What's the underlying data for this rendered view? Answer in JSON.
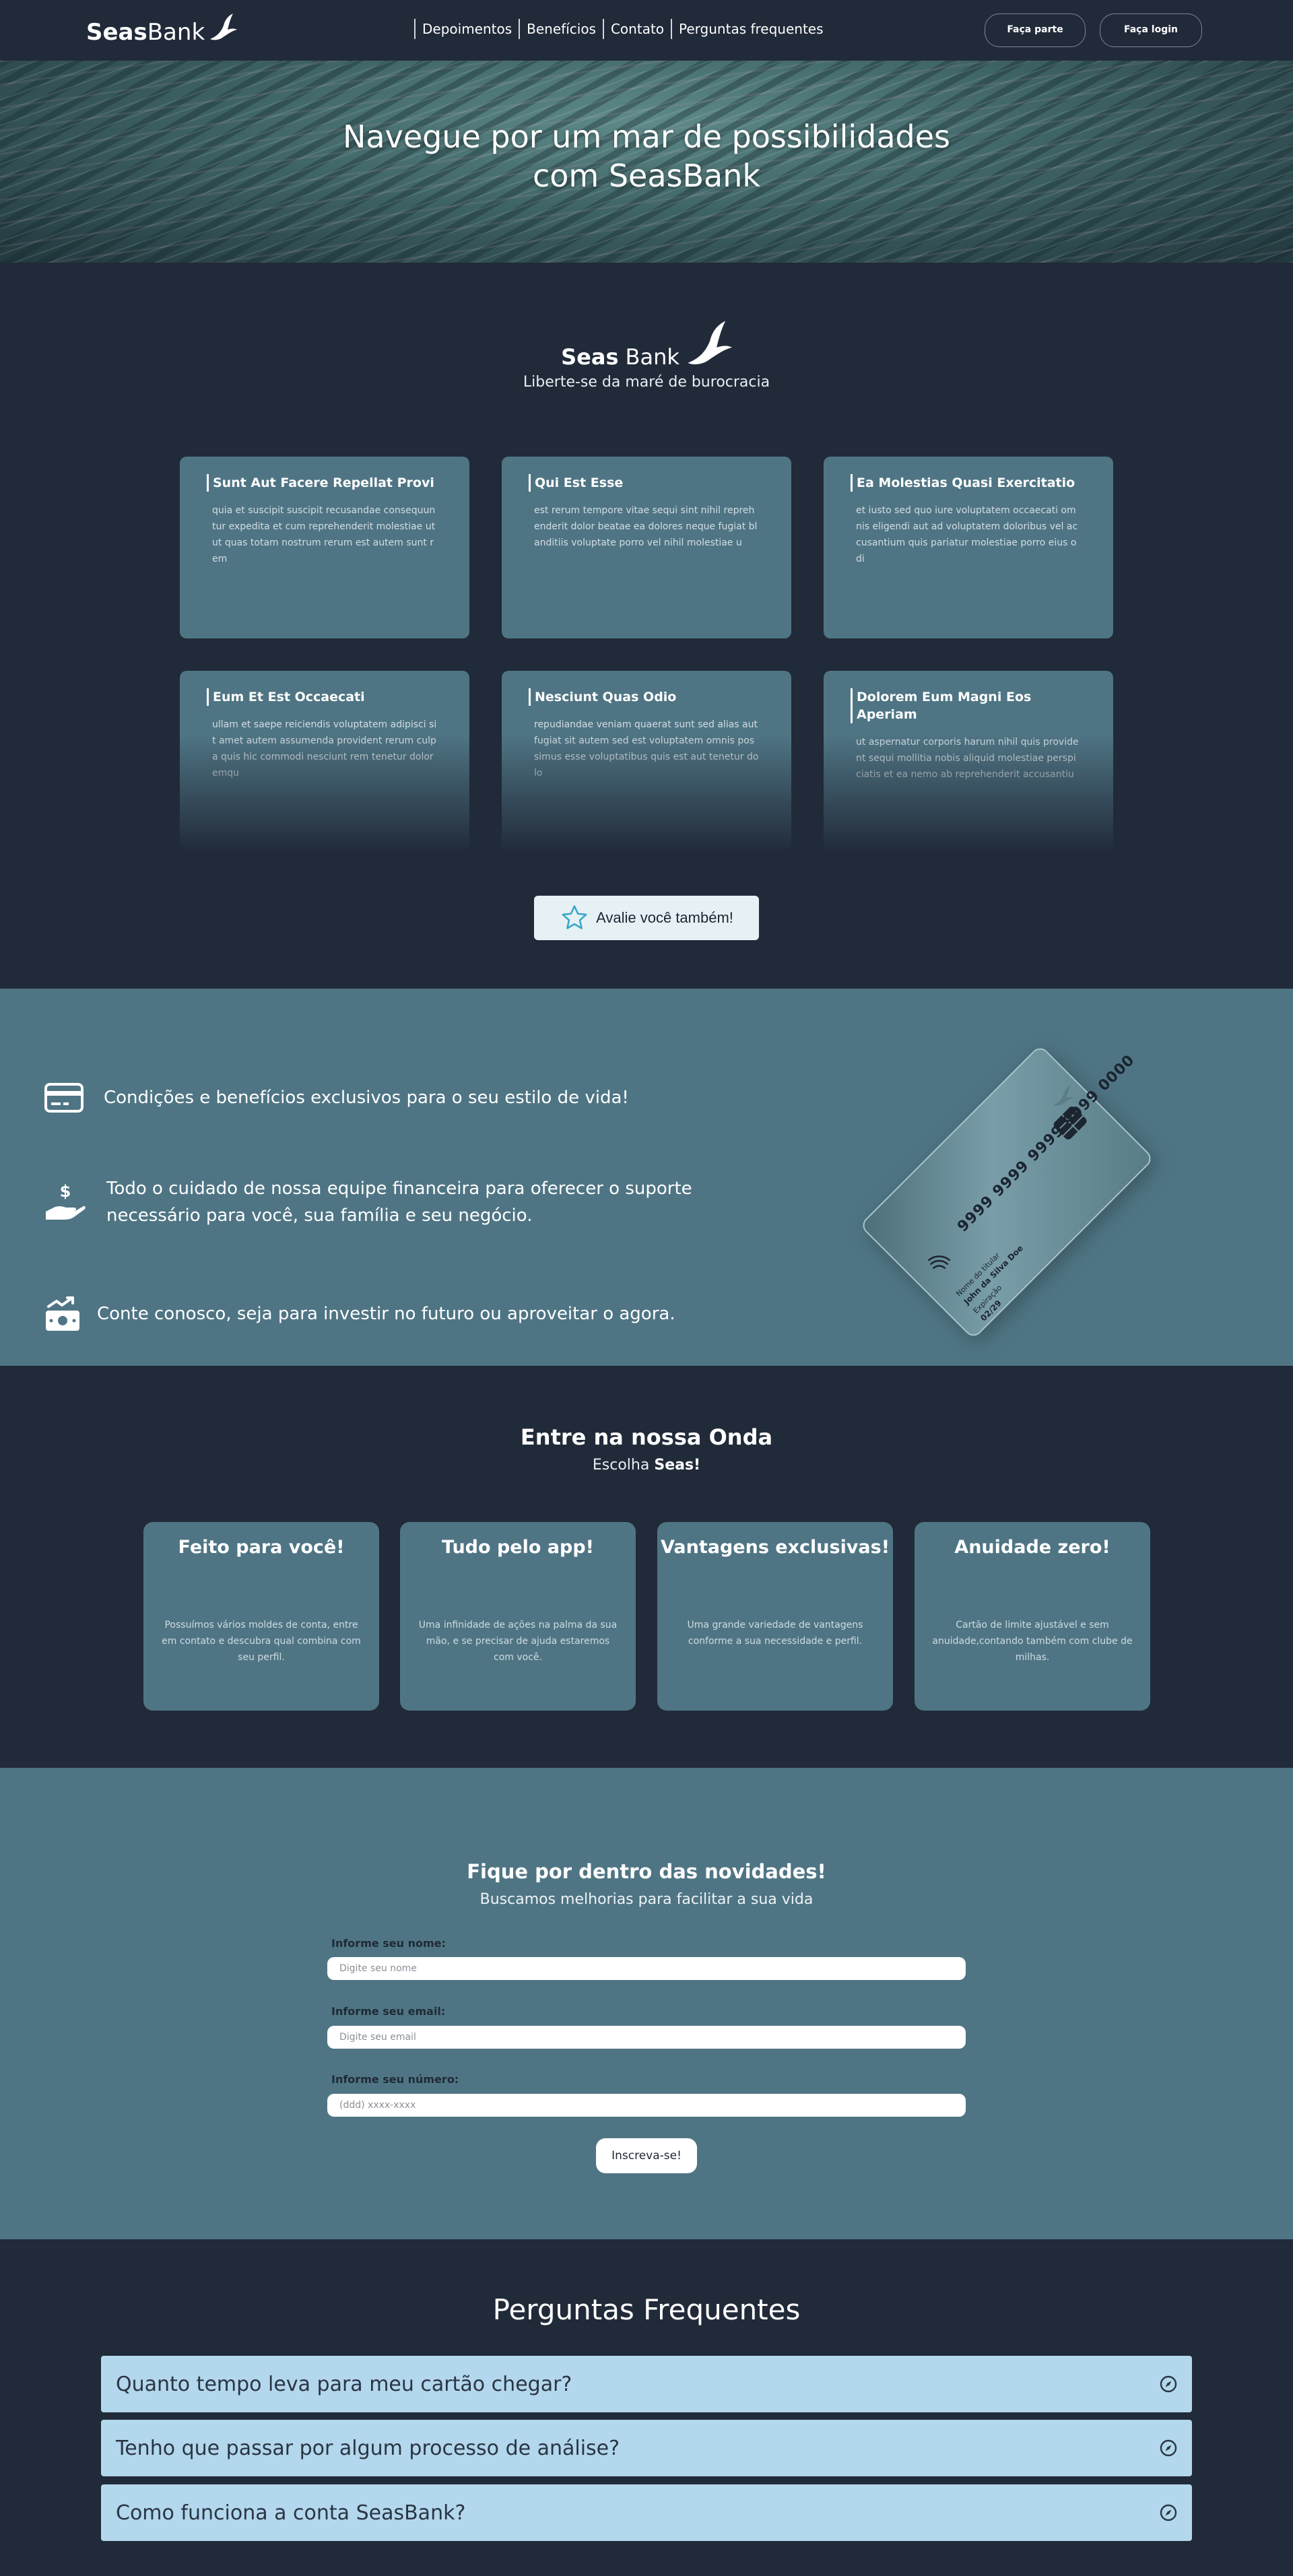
{
  "nav": {
    "logo_bold": "Seas",
    "logo_rest": "Bank",
    "links": [
      "Depoimentos",
      "Benefícios",
      "Contato",
      "Perguntas frequentes"
    ],
    "signup": "Faça parte",
    "login": "Faça login"
  },
  "hero": {
    "title_line1": "Navegue por um mar de possibilidades",
    "title_line2": "com SeasBank"
  },
  "brand": {
    "name_bold": "Seas",
    "name_rest": "Bank",
    "tagline": "Liberte-se da maré de burocracia"
  },
  "testimonials": [
    {
      "title": "Sunt Aut Facere Repellat Provi",
      "body": "quia et suscipit suscipit recusandae consequuntur expedita et cum reprehenderit molestiae ut ut quas totam nostrum rerum est autem sunt rem"
    },
    {
      "title": "Qui Est Esse",
      "body": "est rerum tempore vitae sequi sint nihil reprehenderit dolor beatae ea dolores neque fugiat blanditiis voluptate porro vel nihil molestiae u"
    },
    {
      "title": "Ea Molestias Quasi Exercitatio",
      "body": "et iusto sed quo iure voluptatem occaecati omnis eligendi aut ad voluptatem doloribus vel accusantium quis pariatur molestiae porro eius odi"
    },
    {
      "title": "Eum Et Est Occaecati",
      "body": "ullam et saepe reiciendis voluptatem adipisci sit amet autem assumenda provident rerum culpa quis hic commodi nesciunt rem tenetur doloremqu"
    },
    {
      "title": "Nesciunt Quas Odio",
      "body": "repudiandae veniam quaerat sunt sed alias aut fugiat sit autem sed est voluptatem omnis possimus esse voluptatibus quis est aut tenetur dolo"
    },
    {
      "title": "Dolorem Eum Magni Eos Aperiam",
      "body": "ut aspernatur corporis harum nihil quis provident sequi mollitia nobis aliquid molestiae perspiciatis et ea nemo ab reprehenderit accusantiu"
    }
  ],
  "rate_button": "Avalie você também!",
  "benefits": [
    {
      "icon": "credit-card-icon",
      "text_line1": "Condições e benefícios exclusivos para o seu estilo de vida!",
      "text_line2": ""
    },
    {
      "icon": "hand-money-icon",
      "text_line1": "Todo o cuidado de nossa equipe financeira para oferecer o suporte",
      "text_line2": "necessário para você, sua família e seu negócio."
    },
    {
      "icon": "money-growth-icon",
      "text_line1": "Conte conosco, seja para investir no futuro ou aproveitar o agora.",
      "text_line2": ""
    }
  ],
  "credit_card": {
    "number": "9999 9999 9999 9999 0000",
    "holder_label": "Nome do titular",
    "holder_name": "John da Silva Doe",
    "expiry_label": "Expiração",
    "expiry_value": "02/29"
  },
  "plans": {
    "title": "Entre na nossa Onda",
    "sub_prefix": "Escolha ",
    "sub_bold": "Seas!",
    "cards": [
      {
        "title": "Feito para você!",
        "body": "Possuímos vários moldes de conta, entre em contato e descubra qual combina com seu perfil."
      },
      {
        "title": "Tudo pelo app!",
        "body": "Uma infinidade de ações na palma da sua mão, e se precisar de ajuda estaremos com você."
      },
      {
        "title": "Vantagens exclusivas!",
        "body": "Uma grande variedade de vantagens conforme a sua necessidade e perfil."
      },
      {
        "title": "Anuidade zero!",
        "body": "Cartão de limite ajustável e sem anuidade,contando também com clube de milhas."
      }
    ]
  },
  "newsletter": {
    "title": "Fique por dentro das novidades!",
    "subtitle": "Buscamos melhorias para facilitar a sua vida",
    "name_label": "Informe seu nome:",
    "name_placeholder": "Digite seu nome",
    "email_label": "Informe seu email:",
    "email_placeholder": "Digite seu email",
    "phone_label": "Informe seu número:",
    "phone_placeholder": "(ddd) xxxx-xxxx",
    "submit": "Inscreva-se!"
  },
  "faq": {
    "title": "Perguntas Frequentes",
    "items": [
      "Quanto tempo leva para meu cartão chegar?",
      "Tenho que passar por algum processo de análise?",
      "Como funciona a conta SeasBank?"
    ]
  },
  "colors": {
    "background": "#212a39",
    "panel": "#4f7584",
    "faq_item": "#b3d7ec",
    "button_light": "#e6f1f5"
  }
}
